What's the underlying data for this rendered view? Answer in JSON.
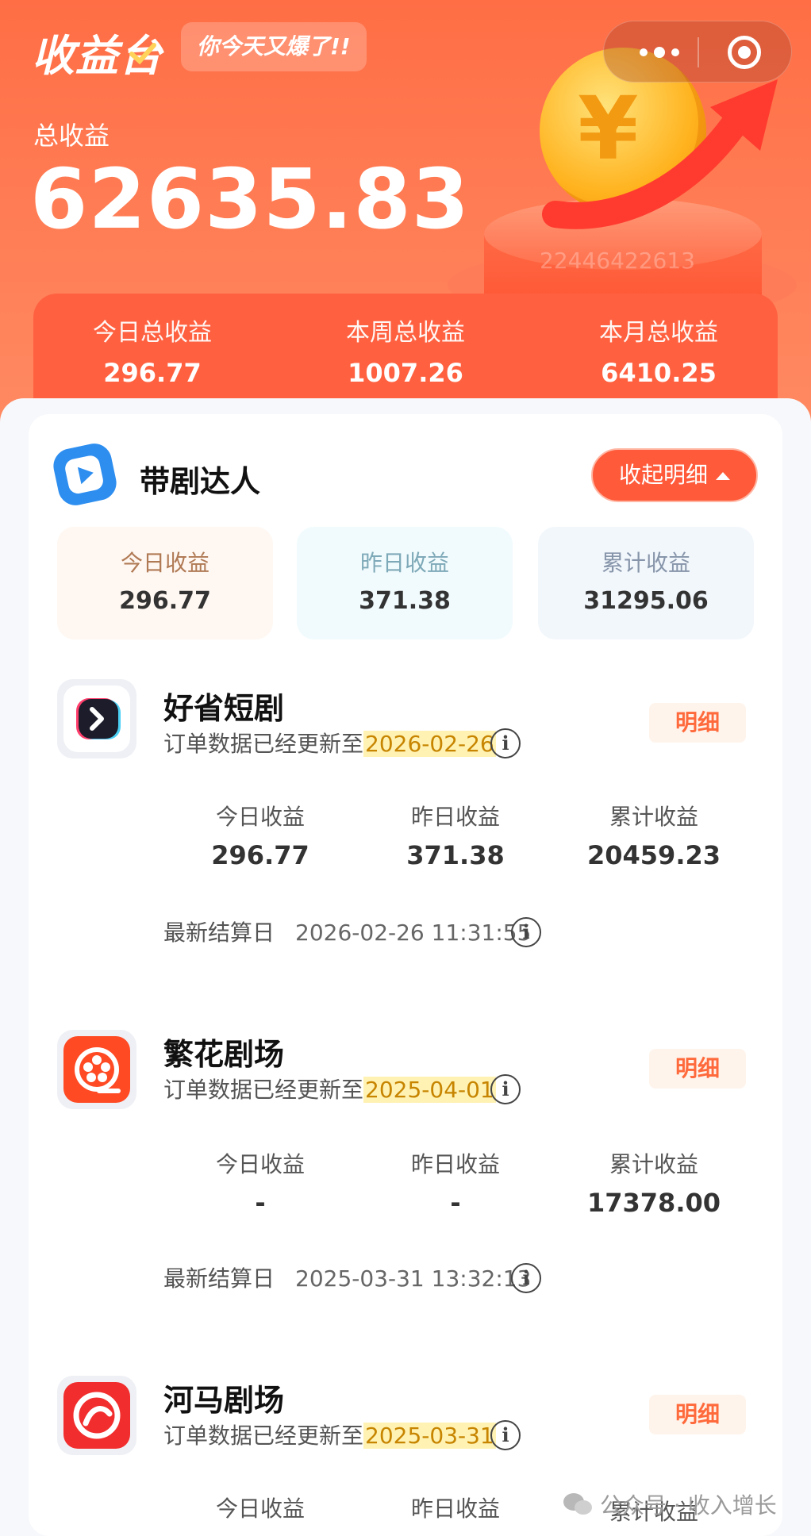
{
  "header": {
    "brand": "收益台",
    "slogan": "你今天又爆了!!",
    "total_label": "总收益",
    "total_value": "62635.83",
    "pedestal_number": "22446422613",
    "stats": [
      {
        "label": "今日总收益",
        "value": "296.77"
      },
      {
        "label": "本周总收益",
        "value": "1007.26"
      },
      {
        "label": "本月总收益",
        "value": "6410.25"
      }
    ]
  },
  "section": {
    "title": "带剧达人",
    "collapse_label": "收起明细",
    "summary": [
      {
        "label": "今日收益",
        "value": "296.77"
      },
      {
        "label": "昨日收益",
        "value": "371.38"
      },
      {
        "label": "累计收益",
        "value": "31295.06"
      }
    ]
  },
  "platforms": [
    {
      "name": "好省短剧",
      "update_prefix": "订单数据已经更新至",
      "update_date": "2026-02-26",
      "detail_label": "明细",
      "cols": [
        {
          "label": "今日收益",
          "value": "296.77"
        },
        {
          "label": "昨日收益",
          "value": "371.38"
        },
        {
          "label": "累计收益",
          "value": "20459.23"
        }
      ],
      "settle_label": "最新结算日",
      "settle_time": "2026-02-26 11:31:55"
    },
    {
      "name": "繁花剧场",
      "update_prefix": "订单数据已经更新至",
      "update_date": "2025-04-01",
      "detail_label": "明细",
      "cols": [
        {
          "label": "今日收益",
          "value": "-"
        },
        {
          "label": "昨日收益",
          "value": "-"
        },
        {
          "label": "累计收益",
          "value": "17378.00"
        }
      ],
      "settle_label": "最新结算日",
      "settle_time": "2025-03-31 13:32:13"
    },
    {
      "name": "河马剧场",
      "update_prefix": "订单数据已经更新至",
      "update_date": "2025-03-31",
      "detail_label": "明细",
      "cols": [
        {
          "label": "今日收益"
        },
        {
          "label": "昨日收益"
        },
        {
          "label": "累计收益"
        }
      ]
    }
  ],
  "info_glyph": "i",
  "watermark": "公众号 · 收入增长",
  "colors": {
    "header_orange": "#ff6e45",
    "stats_bar": "#ff6140",
    "collapse_button": "#ff5a3a",
    "detail_text": "#ff6a3c",
    "date_highlight": "#fff2b3"
  },
  "icons": [
    "wechat-menu-dots-icon",
    "wechat-close-target-icon",
    "play-icon",
    "info-icon",
    "coin-icon"
  ]
}
